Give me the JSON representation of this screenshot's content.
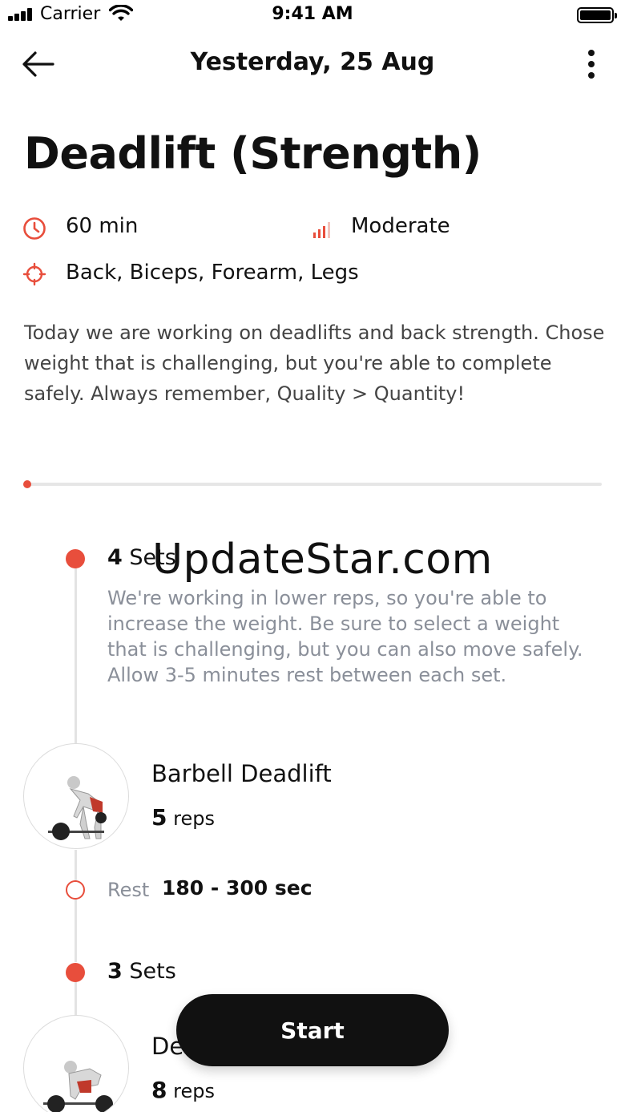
{
  "status_bar": {
    "carrier": "Carrier",
    "time": "9:41 AM"
  },
  "nav": {
    "title": "Yesterday, 25 Aug",
    "back_icon": "arrow-left-icon",
    "more_icon": "more-vertical-icon"
  },
  "workout": {
    "title": "Deadlift (Strength)",
    "duration": "60 min",
    "intensity": "Moderate",
    "muscles": "Back, Biceps, Forearm, Legs",
    "description": "Today we are working on deadlifts and back strength. Chose weight that is challenging, but you're able to complete safely. Always remember, Quality > Quantity!",
    "progress_fraction": 0.0
  },
  "blocks": [
    {
      "sets_count": "4",
      "sets_word": "Sets",
      "description": "We're working in lower reps, so you're able to increase the weight. Be sure to select a weight that is challenging, but you can also move safely. Allow 3-5 minutes rest between each set.",
      "exercise": {
        "name": "Barbell Deadlift",
        "reps_count": "5",
        "reps_word": "reps"
      },
      "rest": {
        "label": "Rest",
        "value": "180 - 300 sec"
      }
    },
    {
      "sets_count": "3",
      "sets_word": "Sets",
      "exercise": {
        "name": "De",
        "reps_count": "8",
        "reps_word": "reps"
      }
    }
  ],
  "watermark": "UpdateStar.com",
  "start_button": "Start",
  "colors": {
    "accent": "#e84e3c",
    "text": "#111111",
    "muted": "#8a8f99",
    "button": "#111111"
  }
}
